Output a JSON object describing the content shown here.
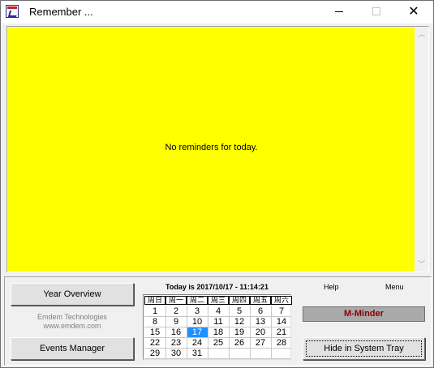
{
  "window": {
    "title": "Remember ...",
    "minimize_label": "",
    "maximize_label": "",
    "close_label": "✕"
  },
  "reminders": {
    "message": "No reminders for today."
  },
  "scrollbar": {
    "up_glyph": "︿",
    "down_glyph": "﹀"
  },
  "left_panel": {
    "year_overview_label": "Year Overview",
    "company_name": "Emdem Technologies",
    "company_url": "www.emdem.com",
    "events_manager_label": "Events Manager"
  },
  "calendar": {
    "today_text": "Today is 2017/10/17 - 11:14:21",
    "weekday_headers": [
      "周日",
      "周一",
      "周二",
      "周三",
      "周四",
      "周五",
      "周六"
    ],
    "weeks": [
      [
        "1",
        "2",
        "3",
        "4",
        "5",
        "6",
        "7"
      ],
      [
        "8",
        "9",
        "10",
        "11",
        "12",
        "13",
        "14"
      ],
      [
        "15",
        "16",
        "17",
        "18",
        "19",
        "20",
        "21"
      ],
      [
        "22",
        "23",
        "24",
        "25",
        "26",
        "27",
        "28"
      ],
      [
        "29",
        "30",
        "31",
        "",
        "",
        "",
        ""
      ]
    ],
    "highlighted_day": "17"
  },
  "right_panel": {
    "help_label": "Help",
    "menu_label": "Menu",
    "brand_label": "M-Minder",
    "hide_tray_label": "Hide in System Tray"
  },
  "colors": {
    "reminder_background": "#ffff00",
    "brand_text": "#8b0000",
    "highlight": "#1e90ff"
  }
}
